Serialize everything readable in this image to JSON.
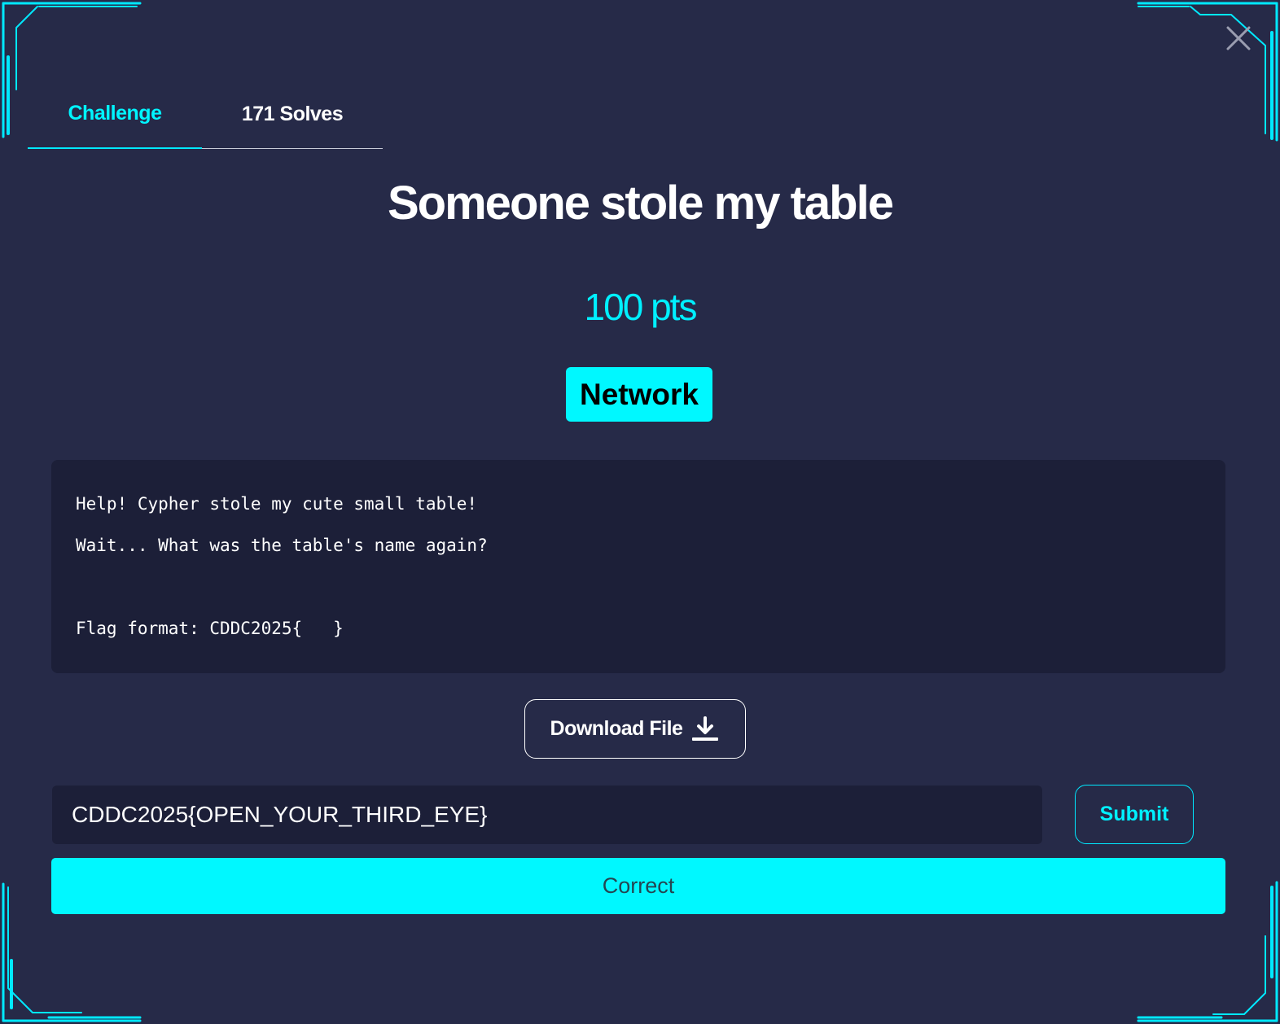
{
  "tabs": [
    {
      "label": "Challenge",
      "active": true
    },
    {
      "label": "171 Solves",
      "active": false
    }
  ],
  "challenge": {
    "title": "Someone stole my table",
    "points": "100 pts",
    "category": "Network",
    "description": {
      "line1": "Help! Cypher stole my cute small table!",
      "line2": "Wait... What was the table's name again?",
      "line3": "Flag format: CDDC2025{   }"
    }
  },
  "download": {
    "label": "Download File",
    "icon": "download-icon"
  },
  "flag_input": {
    "value": "CDDC2025{OPEN_YOUR_THIRD_EYE}"
  },
  "submit": {
    "label": "Submit"
  },
  "result": {
    "message": "Correct"
  },
  "close": {
    "icon": "close-icon"
  },
  "colors": {
    "background": "#262a48",
    "accent": "#00f8ff",
    "panel": "#1c1f38"
  }
}
